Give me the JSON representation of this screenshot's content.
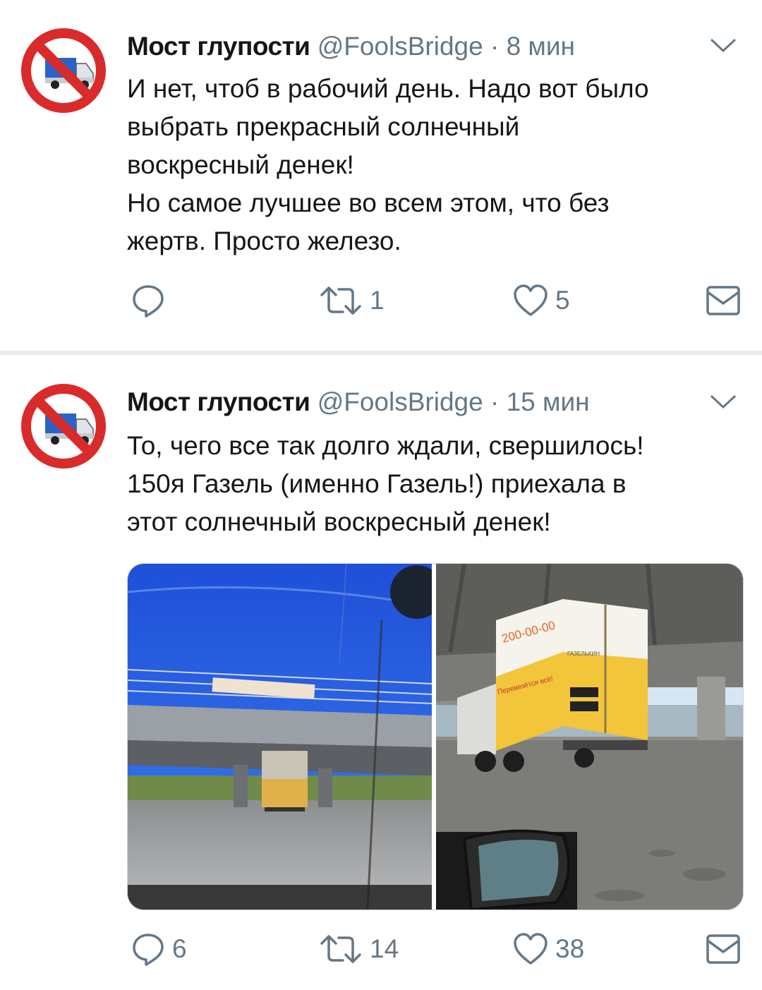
{
  "tweets": [
    {
      "name": "Мост глупости",
      "handle": "@FoolsBridge",
      "separator": "·",
      "time": "8 мин",
      "lines": [
        "И нет, чтоб в рабочий день. Надо вот было",
        "выбрать прекрасный солнечный",
        "воскресный денек!",
        "Но самое лучшее во всем этом, что без",
        "жертв. Просто железо."
      ],
      "replies": "",
      "retweets": "1",
      "likes": "5"
    },
    {
      "name": "Мост глупости",
      "handle": "@FoolsBridge",
      "separator": "·",
      "time": "15 мин",
      "lines": [
        "То, чего все так долго ждали, свершилось!",
        "150я Газель (именно Газель!) приехала в",
        "этот солнечный воскресный денек!"
      ],
      "replies": "6",
      "retweets": "14",
      "likes": "38"
    }
  ],
  "photo_text": {
    "truck_phone": "200-00-00",
    "truck_slogan": "Перевезётся всё!",
    "truck_brand": "ГАЗЕЛЬКИН"
  },
  "colors": {
    "text": "#14171a",
    "secondary": "#657786",
    "divider": "#e6ecf0",
    "avatar_ban": "#d92b2b",
    "truck_yellow": "#f2c53a"
  },
  "icons": {
    "reply": "speech-bubble-icon",
    "retweet": "retweet-arrows-icon",
    "like": "heart-icon",
    "message": "envelope-icon",
    "menu": "chevron-down-icon"
  }
}
